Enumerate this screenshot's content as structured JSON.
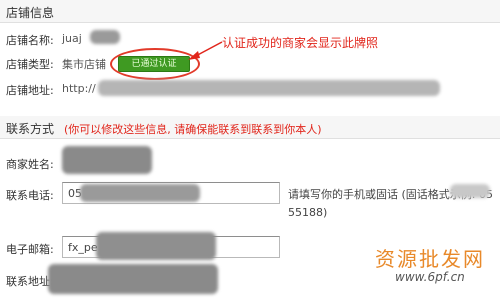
{
  "sections": {
    "store_info": {
      "title": "店铺信息"
    },
    "contact": {
      "title": "联系方式",
      "note": "(你可以修改这些信息, 请确保能联系到联系到你本人)",
      "note_color": "#e1251b"
    }
  },
  "store": {
    "name_label": "店铺名称:",
    "name_value": "juaj",
    "type_label": "店铺类型:",
    "type_value": "集市店铺",
    "badge_text": "已通过认证",
    "address_label": "店铺地址:",
    "address_value": "http://"
  },
  "annotation": {
    "text": "认证成功的商家会显示此牌照",
    "color": "#e1251b"
  },
  "contact": {
    "merchant_name_label": "商家姓名:",
    "phone_label": "联系电话:",
    "phone_value": "05",
    "phone_hint_line1": "请填写你的手机或固话 (固话格式示例: 05",
    "phone_hint_line2": "55188)",
    "email_label": "电子邮箱:",
    "email_value": "fx_pe",
    "address_label": "联系地址:"
  },
  "watermark": {
    "cn": "资源批发网",
    "url": "www.6pf.cn",
    "color": "#e8892a"
  },
  "icons": {
    "annotation_arrow": "red-arrow-icon"
  }
}
